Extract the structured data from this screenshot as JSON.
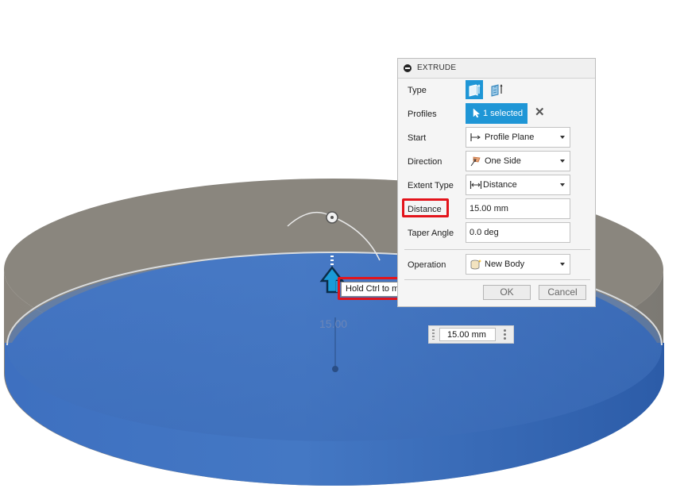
{
  "viewport": {
    "dimension_label": "15.00",
    "distance_value": "15.00 mm",
    "tooltip": "Hold Ctrl to modify selection"
  },
  "dialog": {
    "title": "EXTRUDE",
    "type": {
      "label": "Type",
      "options": [
        "solid-extrude-icon",
        "surface-extrude-icon"
      ],
      "active": 0
    },
    "profiles": {
      "label": "Profiles",
      "value": "1 selected"
    },
    "start": {
      "label": "Start",
      "value": "Profile Plane",
      "icon": "profile-plane-icon"
    },
    "direction": {
      "label": "Direction",
      "value": "One Side",
      "icon": "one-side-icon"
    },
    "extent_type": {
      "label": "Extent Type",
      "value": "Distance",
      "icon": "distance-icon"
    },
    "distance": {
      "label": "Distance",
      "value": "15.00 mm"
    },
    "taper_angle": {
      "label": "Taper Angle",
      "value": "0.0 deg"
    },
    "operation": {
      "label": "Operation",
      "value": "New Body",
      "icon": "new-body-icon"
    },
    "ok_label": "OK",
    "cancel_label": "Cancel"
  },
  "colors": {
    "accent": "#1f96d6",
    "highlight": "#e3141b",
    "face_blue": "#3f71be",
    "side_gray": "#8b8780"
  }
}
